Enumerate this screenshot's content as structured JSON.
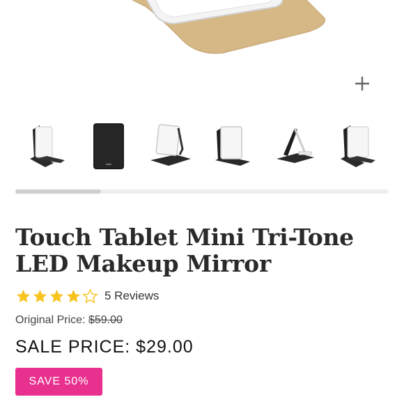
{
  "product": {
    "title": "Touch Tablet Mini Tri-Tone LED Makeup Mirror",
    "rating": 4,
    "rating_max": 5,
    "reviews_label": "5 Reviews",
    "original_price_label": "Original Price:",
    "original_price": "$59.00",
    "sale_price_label": "SALE PRICE: $29.00",
    "discount_badge": "SAVE 50%"
  },
  "gallery": {
    "thumbnail_count": 6,
    "scroll_progress": 0.23,
    "zoom_icon": "plus-icon"
  },
  "colors": {
    "badge": "#e8318f",
    "star_filled": "#f7c31e",
    "star_empty": "#f7c31e",
    "case_tan": "#d8b98a"
  }
}
